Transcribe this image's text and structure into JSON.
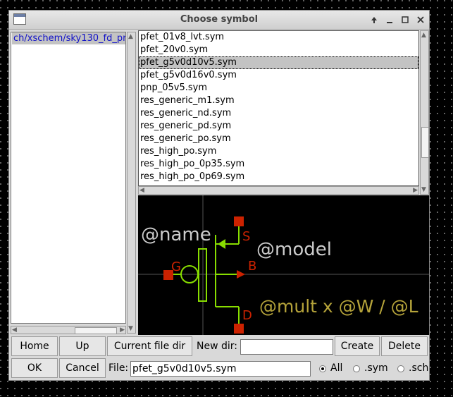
{
  "window": {
    "title": "Choose symbol"
  },
  "left_panel": {
    "dir_item": "ch/xschem/sky130_fd_pr"
  },
  "file_list": {
    "items": [
      "pfet_01v8_lvt.sym",
      "pfet_20v0.sym",
      "pfet_g5v0d10v5.sym",
      "pfet_g5v0d16v0.sym",
      "pnp_05v5.sym",
      "res_generic_m1.sym",
      "res_generic_nd.sym",
      "res_generic_pd.sym",
      "res_generic_po.sym",
      "res_high_po.sym",
      "res_high_po_0p35.sym",
      "res_high_po_0p69.sym"
    ],
    "selected": "pfet_g5v0d10v5.sym"
  },
  "preview": {
    "name_label": "@name",
    "model_label": "@model",
    "mult_label": "@mult x @W / @L",
    "pin_s": "S",
    "pin_g": "G",
    "pin_b": "B",
    "pin_d": "D",
    "colors": {
      "wire": "#88dd00",
      "pin": "#cc2200",
      "text": "#cccccc",
      "mult": "#b5a33a"
    }
  },
  "buttons": {
    "home": "Home",
    "up": "Up",
    "current_dir": "Current file dir",
    "create": "Create",
    "delete": "Delete",
    "ok": "OK",
    "cancel": "Cancel"
  },
  "labels": {
    "new_dir": "New dir:",
    "file": "File:"
  },
  "inputs": {
    "new_dir_value": "",
    "file_value": "pfet_g5v0d10v5.sym"
  },
  "filter": {
    "options": [
      "All",
      ".sym",
      ".sch"
    ],
    "selected": "All"
  }
}
